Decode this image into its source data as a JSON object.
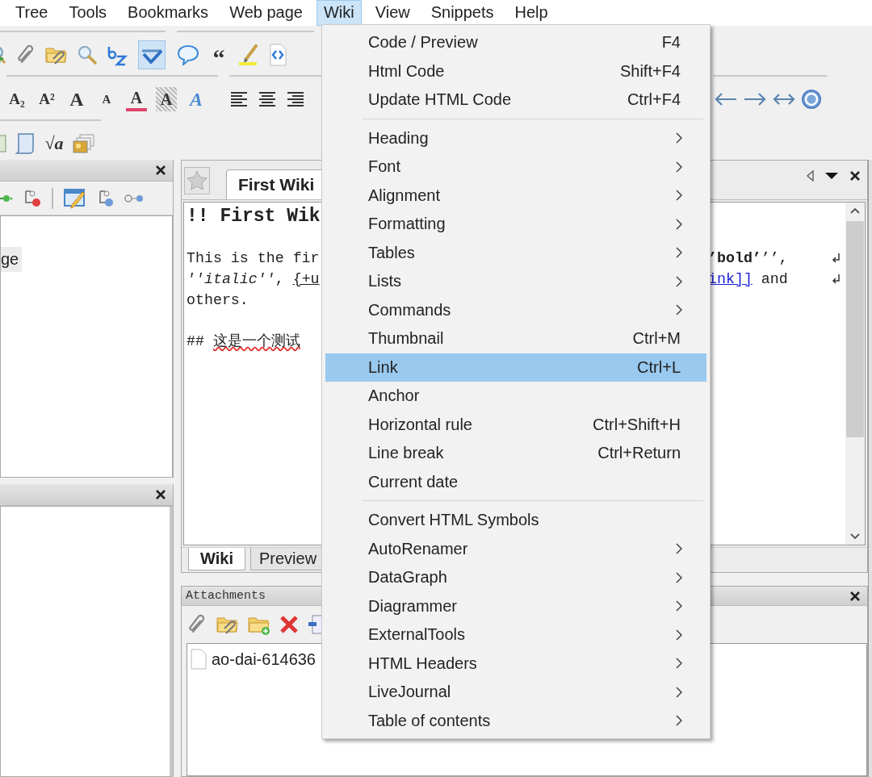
{
  "menubar": [
    {
      "label": "Tree",
      "selected": false
    },
    {
      "label": "Tools",
      "selected": false
    },
    {
      "label": "Bookmarks",
      "selected": false
    },
    {
      "label": "Web page",
      "selected": false
    },
    {
      "label": "Wiki",
      "selected": true
    },
    {
      "label": "View",
      "selected": false
    },
    {
      "label": "Snippets",
      "selected": false
    },
    {
      "label": "Help",
      "selected": false
    }
  ],
  "toolbar": {
    "spellcheck_pressed": true,
    "glyphs": [
      "“",
      "A₂",
      "A²",
      "A",
      "A",
      "A",
      "A",
      "A",
      "√a"
    ]
  },
  "tree": {
    "items": [
      {
        "label": "ge",
        "selected": true
      }
    ]
  },
  "editor": {
    "tabs": [
      {
        "label": "First Wiki",
        "selected": true
      }
    ],
    "lines": [
      {
        "kind": "heading",
        "left": [
          {
            "kind": "plain",
            "text": "!! First Wik"
          }
        ],
        "wrap": false
      },
      {
        "kind": "blank",
        "wrap": false
      },
      {
        "kind": "text",
        "left": [
          {
            "kind": "plain",
            "text": "This is the fir"
          }
        ],
        "right": [
          {
            "kind": "plain",
            "text": "**’bold’**’’,"
          }
        ],
        "wrap": true
      },
      {
        "kind": "text",
        "left": [
          {
            "kind": "plain",
            "text": "*''italic''*, "
          },
          {
            "kind": "underline",
            "text": "{+u"
          }
        ],
        "right": [
          {
            "kind": "link",
            "text": "ink]]"
          },
          {
            "kind": "plain",
            "text": " and"
          }
        ],
        "wrap": true
      },
      {
        "kind": "text",
        "left": [
          {
            "kind": "plain",
            "text": "others."
          }
        ],
        "wrap": false
      },
      {
        "kind": "blank",
        "wrap": false
      },
      {
        "kind": "text",
        "left": [
          {
            "kind": "plain",
            "text": "## "
          },
          {
            "kind": "misspelled",
            "text": "这是一个测试"
          }
        ],
        "wrap": false
      }
    ],
    "view_tabs": [
      {
        "label": "Wiki",
        "selected": true
      },
      {
        "label": "Preview",
        "selected": false
      }
    ]
  },
  "attachments": {
    "title": "Attachments",
    "files": [
      "ao-dai-614636"
    ]
  },
  "menu": {
    "items": [
      {
        "kind": "item",
        "label": "Code / Preview",
        "shortcut": "F4",
        "submenu": false,
        "selected": false
      },
      {
        "kind": "item",
        "label": "Html Code",
        "shortcut": "Shift+F4",
        "submenu": false,
        "selected": false
      },
      {
        "kind": "item",
        "label": "Update HTML Code",
        "shortcut": "Ctrl+F4",
        "submenu": false,
        "selected": false
      },
      {
        "kind": "separator"
      },
      {
        "kind": "item",
        "label": "Heading",
        "submenu": true,
        "selected": false
      },
      {
        "kind": "item",
        "label": "Font",
        "submenu": true,
        "selected": false
      },
      {
        "kind": "item",
        "label": "Alignment",
        "submenu": true,
        "selected": false
      },
      {
        "kind": "item",
        "label": "Formatting",
        "submenu": true,
        "selected": false
      },
      {
        "kind": "item",
        "label": "Tables",
        "submenu": true,
        "selected": false
      },
      {
        "kind": "item",
        "label": "Lists",
        "submenu": true,
        "selected": false
      },
      {
        "kind": "item",
        "label": "Commands",
        "submenu": true,
        "selected": false
      },
      {
        "kind": "item",
        "label": "Thumbnail",
        "shortcut": "Ctrl+M",
        "submenu": false,
        "selected": false
      },
      {
        "kind": "item",
        "label": "Link",
        "shortcut": "Ctrl+L",
        "submenu": false,
        "selected": true
      },
      {
        "kind": "item",
        "label": "Anchor",
        "submenu": false,
        "selected": false
      },
      {
        "kind": "item",
        "label": "Horizontal rule",
        "shortcut": "Ctrl+Shift+H",
        "submenu": false,
        "selected": false
      },
      {
        "kind": "item",
        "label": "Line break",
        "shortcut": "Ctrl+Return",
        "submenu": false,
        "selected": false
      },
      {
        "kind": "item",
        "label": "Current date",
        "submenu": false,
        "selected": false
      },
      {
        "kind": "separator"
      },
      {
        "kind": "item",
        "label": "Convert HTML Symbols",
        "submenu": false,
        "selected": false
      },
      {
        "kind": "item",
        "label": "AutoRenamer",
        "submenu": true,
        "selected": false
      },
      {
        "kind": "item",
        "label": "DataGraph",
        "submenu": true,
        "selected": false
      },
      {
        "kind": "item",
        "label": "Diagrammer",
        "submenu": true,
        "selected": false
      },
      {
        "kind": "item",
        "label": "ExternalTools",
        "submenu": true,
        "selected": false
      },
      {
        "kind": "item",
        "label": "HTML Headers",
        "submenu": true,
        "selected": false
      },
      {
        "kind": "item",
        "label": "LiveJournal",
        "submenu": true,
        "selected": false
      },
      {
        "kind": "item",
        "label": "Table of contents",
        "submenu": true,
        "selected": false
      }
    ]
  }
}
